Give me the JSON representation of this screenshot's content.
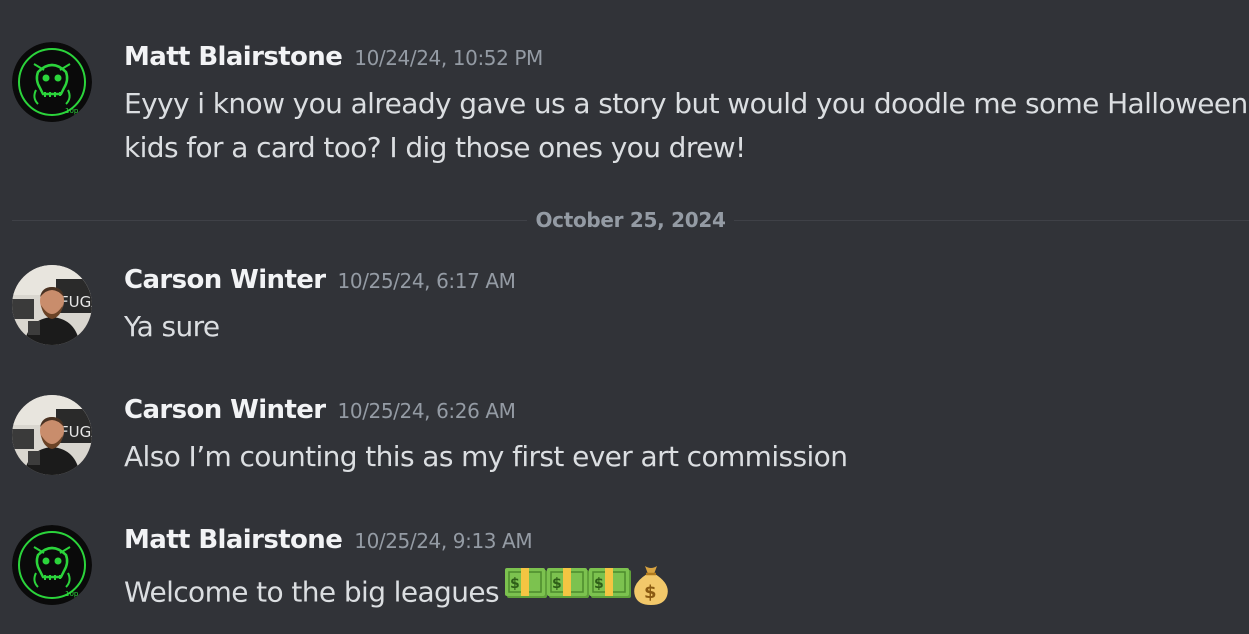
{
  "colors": {
    "background": "#313338",
    "username": "#f2f3f5",
    "timestamp": "#949ba4",
    "message_text": "#dbdee1",
    "divider": "#3f4147",
    "matt_avatar_accent": "#2bd43b"
  },
  "messages": [
    {
      "author": "Matt Blairstone",
      "timestamp": "10/24/24, 10:52 PM",
      "avatar_icon": "skull-logo-avatar",
      "lines": [
        "Eyyy i know you already gave us a story but would you doodle me some Halloween",
        "kids for a card too? I dig those ones you drew!"
      ]
    },
    {
      "author": "Carson Winter",
      "timestamp": "10/25/24, 6:17 AM",
      "avatar_icon": "photo-avatar",
      "lines": [
        "Ya sure"
      ]
    },
    {
      "author": "Carson Winter",
      "timestamp": "10/25/24, 6:26 AM",
      "avatar_icon": "photo-avatar",
      "lines": [
        "Also I’m counting this as my first ever art commission"
      ]
    },
    {
      "author": "Matt Blairstone",
      "timestamp": "10/25/24, 9:13 AM",
      "avatar_icon": "skull-logo-avatar",
      "lines": [
        "Welcome to the big leagues"
      ],
      "emojis": [
        "dollar-bill-emoji",
        "dollar-bill-emoji",
        "dollar-bill-emoji",
        "money-bag-emoji"
      ]
    }
  ],
  "divider": {
    "date": "October 25, 2024"
  }
}
